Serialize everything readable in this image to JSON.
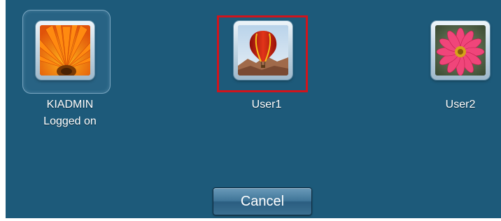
{
  "users": [
    {
      "name": "KIADMIN",
      "status": "Logged on",
      "picture": "orange-gerbera-flower"
    },
    {
      "name": "User1",
      "picture": "hot-air-balloon"
    },
    {
      "name": "User2",
      "picture": "pink-dahlia-flower"
    }
  ],
  "cancel_label": "Cancel",
  "colors": {
    "background": "#1d5a7a",
    "highlight": "#d0141c",
    "text": "#ffffff"
  }
}
